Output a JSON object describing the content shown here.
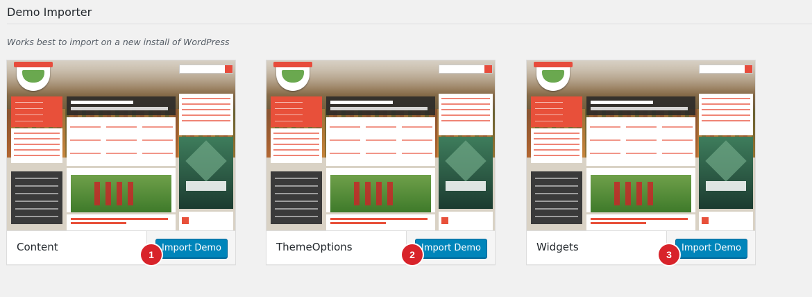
{
  "page": {
    "title": "Demo Importer",
    "subtitle": "Works best to import on a new install of WordPress"
  },
  "theme": {
    "accent": "#0085ba",
    "badge_color": "#d8232a"
  },
  "demos": [
    {
      "name": "Content",
      "button_label": "Import Demo",
      "badge": "1"
    },
    {
      "name": "ThemeOptions",
      "button_label": "Import Demo",
      "badge": "2"
    },
    {
      "name": "Widgets",
      "button_label": "Import Demo",
      "badge": "3"
    }
  ]
}
